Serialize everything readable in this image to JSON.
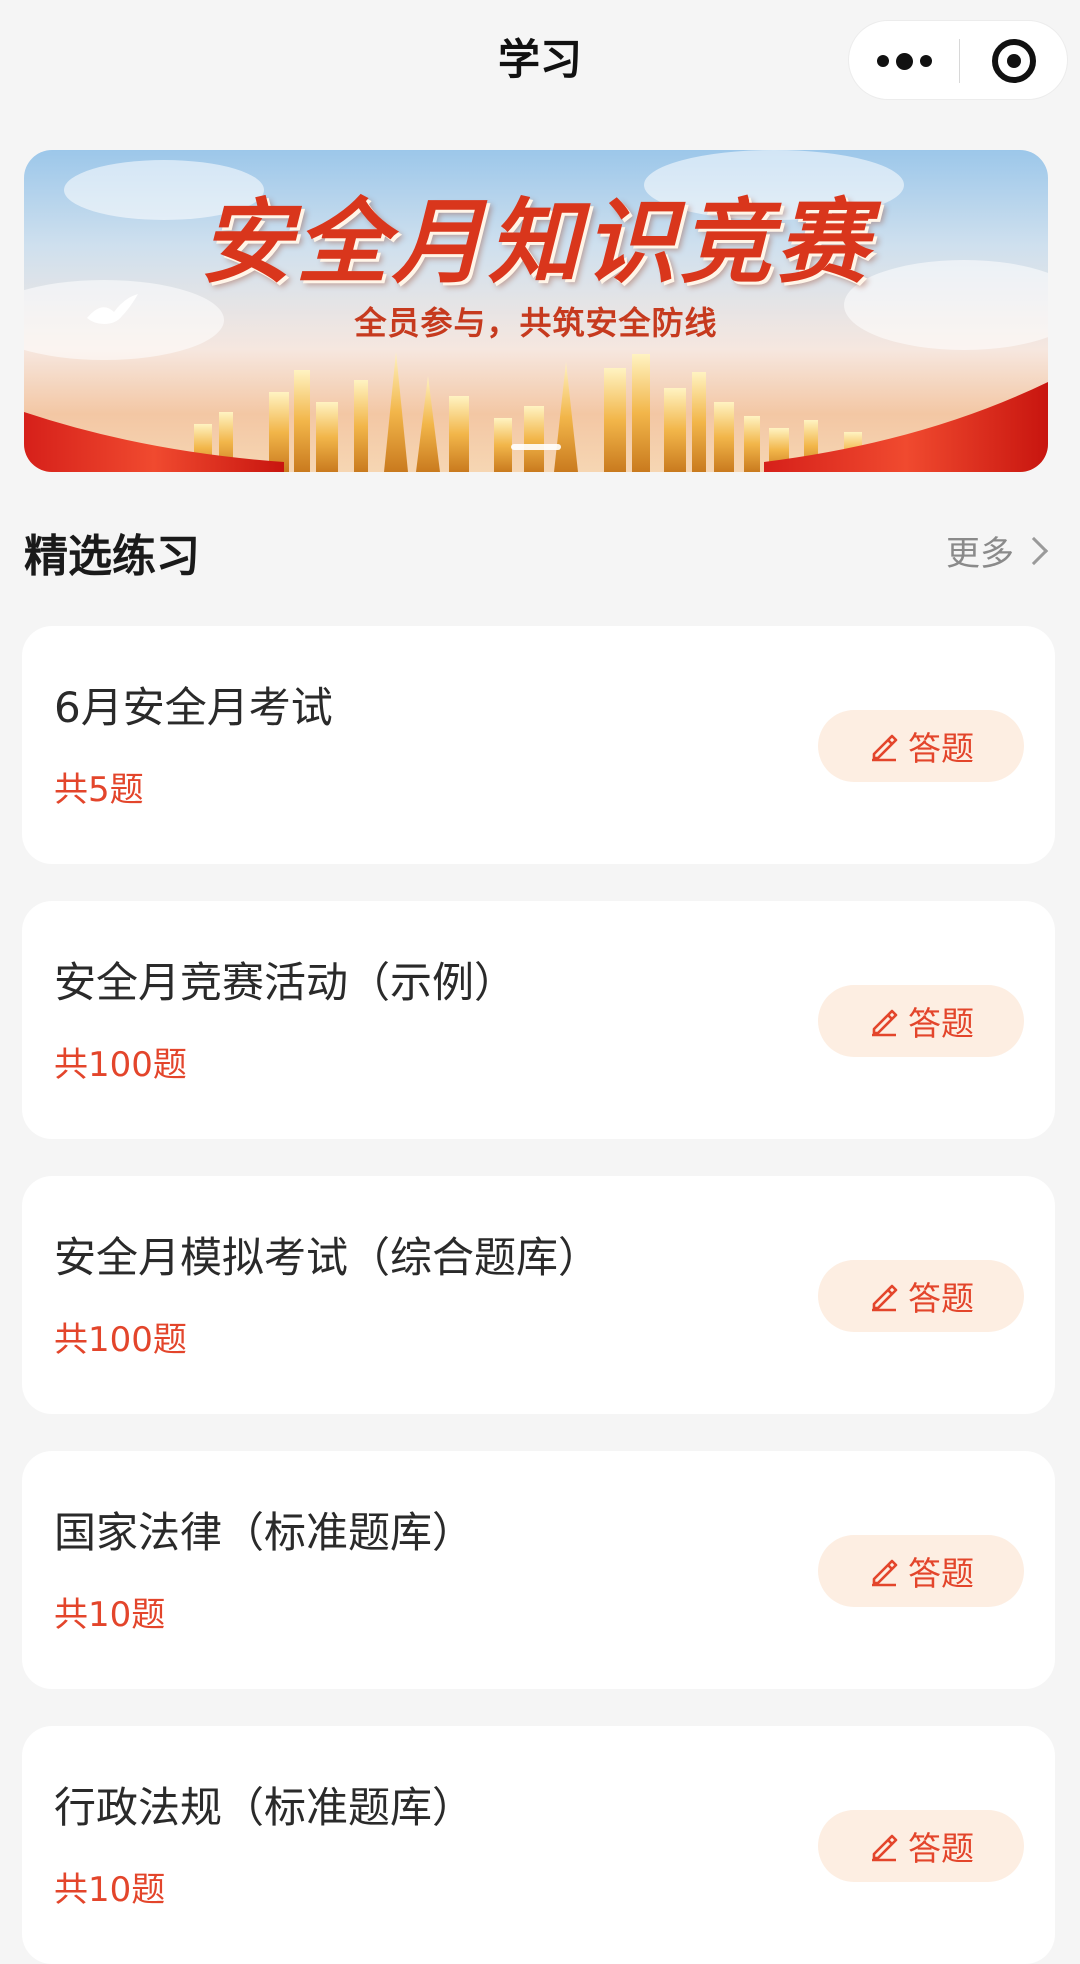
{
  "nav": {
    "title": "学习"
  },
  "banner": {
    "title": "安全月知识竞赛",
    "subtitle": "全员参与，共筑安全防线"
  },
  "section": {
    "title": "精选练习",
    "more_label": "更多"
  },
  "practices": [
    {
      "title": "6月安全月考试",
      "count": "共5题",
      "button": "答题"
    },
    {
      "title": "安全月竞赛活动（示例）",
      "count": "共100题",
      "button": "答题"
    },
    {
      "title": "安全月模拟考试（综合题库）",
      "count": "共100题",
      "button": "答题"
    },
    {
      "title": "国家法律（标准题库）",
      "count": "共10题",
      "button": "答题"
    },
    {
      "title": "行政法规（标准题库）",
      "count": "共10题",
      "button": "答题"
    }
  ],
  "colors": {
    "accent": "#e3452b",
    "button_bg": "#fdeee2",
    "page_bg": "#f5f5f5"
  },
  "icons": {
    "more": "more-dots-icon",
    "close": "capsule-target-icon",
    "edit": "pencil-icon",
    "chevron": "chevron-right-icon"
  }
}
